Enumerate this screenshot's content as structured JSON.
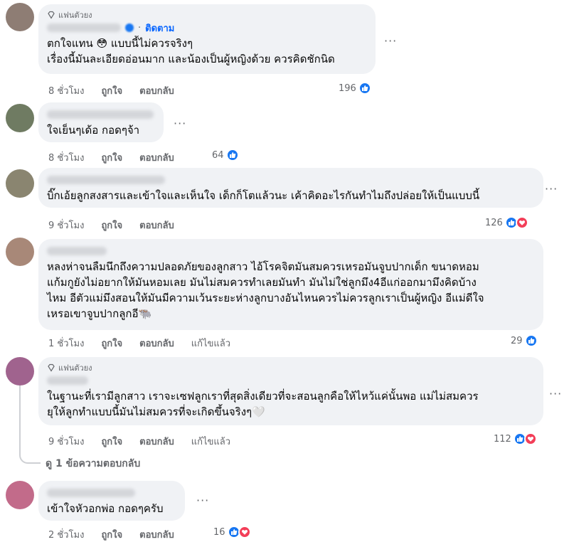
{
  "colors": {
    "accent": "#0866ff",
    "like": "#1877f2",
    "love": "#f33e58",
    "bubble": "#f0f2f5",
    "meta": "#65676b"
  },
  "labels": {
    "fan_badge": "แฟนตัวยง",
    "follow": "ติดตาม",
    "like": "ถูกใจ",
    "reply": "ตอบกลับ",
    "edited": "แก้ไขแล้ว",
    "more": "···",
    "view_replies": "ดู 1 ข้อความตอบกลับ"
  },
  "comments": [
    {
      "time": "8 ชั่วโมง",
      "text": "ตกใจแทน 😳 แบบนี้ไม่ควรจริงๆ\nเรื่องนี้มันละเอียดอ่อนมาก และน้องเป็นผู้หญิงด้วย ควรคิดชักนิด",
      "reactions": "196",
      "reaction_types": [
        "like-icon"
      ]
    },
    {
      "time": "8 ชั่วโมง",
      "text": "ใจเย็นๆเด้อ กอดๆจ้า",
      "reactions": "64",
      "reaction_types": [
        "like-icon"
      ]
    },
    {
      "time": "9 ชั่วโมง",
      "text": "บิ๊กเอ้ยลูกสงสารและเข้าใจและเห็นใจ เด็กก็โตแล้วนะ เค้าคิดอะไรกันทำไมถึงปล่อยให้เป็นแบบนี้",
      "reactions": "126",
      "reaction_types": [
        "like-icon",
        "love-icon"
      ]
    },
    {
      "time": "1 ชั่วโมง",
      "text": "หลงห่าจนลืมนึกถึงความปลอดภัยของลูกสาว ไอ้โรคจิตมันสมควรเหรอมันจูบปากเด็ก ขนาดหอม\nแก้มกูยังไม่อยากให้มันหอมเลย มันไม่สมควรทำเลยมันทำ มันไม่ใช่ลูกมึง4อีแก่ออกมามึงคิดบ้าง\nไหม อีตัวแม่มึงสอนให้มันมีความเว้นระยะห่างลูกบางอันไหนควรไม่ควรลูกเราเป็นผู้หญิง อีแม่ดีใจ\nเหรอเขาจูบปากลูกอี🐃",
      "reactions": "29",
      "reaction_types": [
        "like-icon"
      ]
    },
    {
      "time": "9 ชั่วโมง",
      "text": "ในฐานะที่เรามีลูกสาว เราจะเซฟลูกเราที่สุดสิ่งเดียวที่จะสอนลูกคือให้ไหว้แค่นั้นพอ แม่ไม่สมควร\nยุให้ลูกทำแบบนี้มันไม่สมควรที่จะเกิดขึ้นจริงๆ🤍",
      "reactions": "112",
      "reaction_types": [
        "like-icon",
        "love-icon"
      ]
    },
    {
      "time": "2 ชั่วโมง",
      "text": "เข้าใจหัวอกพ่อ กอดๆครับ",
      "reactions": "16",
      "reaction_types": [
        "like-icon",
        "love-icon"
      ]
    }
  ]
}
